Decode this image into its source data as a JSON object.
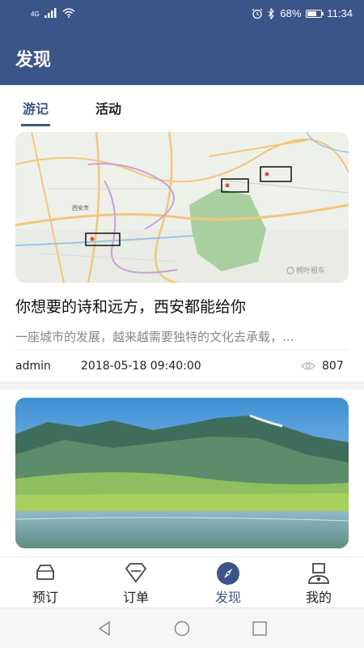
{
  "status_bar": {
    "network": "4G",
    "battery": "68%",
    "battery_level": 0.68,
    "time": "11:34"
  },
  "header": {
    "title": "发现"
  },
  "tabs": [
    {
      "label": "游记",
      "active": true
    },
    {
      "label": "活动",
      "active": false
    }
  ],
  "articles": [
    {
      "title": "你想要的诗和远方，西安都能给你",
      "excerpt": "一座城市的发展，越来越需要独特的文化去承载，...",
      "author": "admin",
      "date": "2018-05-18 09:40:00",
      "views": "807",
      "image": "map-image",
      "map_labels": {
        "city": "西安市",
        "watermark": "桐叶租车"
      }
    },
    {
      "image": "landscape-image"
    }
  ],
  "bottom_nav": [
    {
      "label": "预订",
      "icon": "car-icon",
      "active": false
    },
    {
      "label": "订单",
      "icon": "diamond-icon",
      "active": false
    },
    {
      "label": "发现",
      "icon": "compass-icon",
      "active": true
    },
    {
      "label": "我的",
      "icon": "user-icon",
      "active": false
    }
  ],
  "colors": {
    "primary": "#3c5589",
    "text": "#222222",
    "muted": "#888888"
  },
  "system_nav": [
    "back-icon",
    "home-icon",
    "recents-icon"
  ]
}
